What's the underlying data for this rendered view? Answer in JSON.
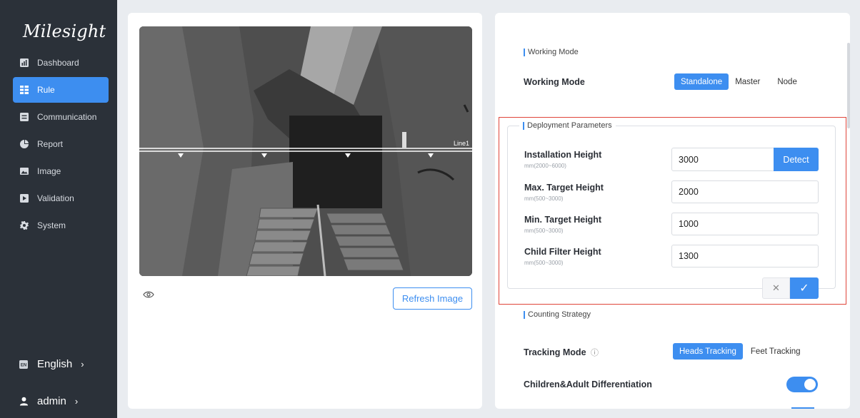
{
  "sidebar": {
    "logo": "Milesight",
    "items": [
      {
        "label": "Dashboard",
        "icon": "dashboard-icon",
        "active": false
      },
      {
        "label": "Rule",
        "icon": "rule-icon",
        "active": true
      },
      {
        "label": "Communication",
        "icon": "communication-icon",
        "active": false
      },
      {
        "label": "Report",
        "icon": "report-icon",
        "active": false
      },
      {
        "label": "Image",
        "icon": "image-icon",
        "active": false
      },
      {
        "label": "Validation",
        "icon": "validation-icon",
        "active": false
      },
      {
        "label": "System",
        "icon": "system-icon",
        "active": false
      }
    ],
    "language": {
      "label": "English",
      "icon": "language-icon",
      "chevron": "›"
    },
    "user": {
      "label": "admin",
      "icon": "user-icon",
      "chevron": "›"
    }
  },
  "preview": {
    "line_label": "Line1",
    "refresh_label": "Refresh Image",
    "eye_icon": "eye-icon"
  },
  "working_mode": {
    "section_title": "Working Mode",
    "label": "Working Mode",
    "options": [
      "Standalone",
      "Master",
      "Node"
    ],
    "selected": "Standalone"
  },
  "deployment": {
    "section_title": "Deployment Parameters",
    "fields": [
      {
        "label": "Installation Height",
        "range": "mm(2000~6000)",
        "value": "3000"
      },
      {
        "label": "Max. Target Height",
        "range": "mm(500~3000)",
        "value": "2000"
      },
      {
        "label": "Min. Target Height",
        "range": "mm(500~3000)",
        "value": "1000"
      },
      {
        "label": "Child Filter Height",
        "range": "mm(500~3000)",
        "value": "1300"
      }
    ],
    "detect_label": "Detect",
    "cancel_symbol": "✕",
    "confirm_symbol": "✓"
  },
  "counting": {
    "section_title": "Counting Strategy",
    "tracking_label": "Tracking Mode",
    "tracking_info_symbol": "ⓘ",
    "tracking_options": [
      "Heads Tracking",
      "Feet Tracking"
    ],
    "tracking_selected": "Heads Tracking",
    "children_label": "Children&Adult Differentiation",
    "children_enabled": true
  },
  "colors": {
    "accent": "#3d8ef0",
    "sidebar_bg": "#2b3139",
    "highlight_border": "#e0453a"
  }
}
